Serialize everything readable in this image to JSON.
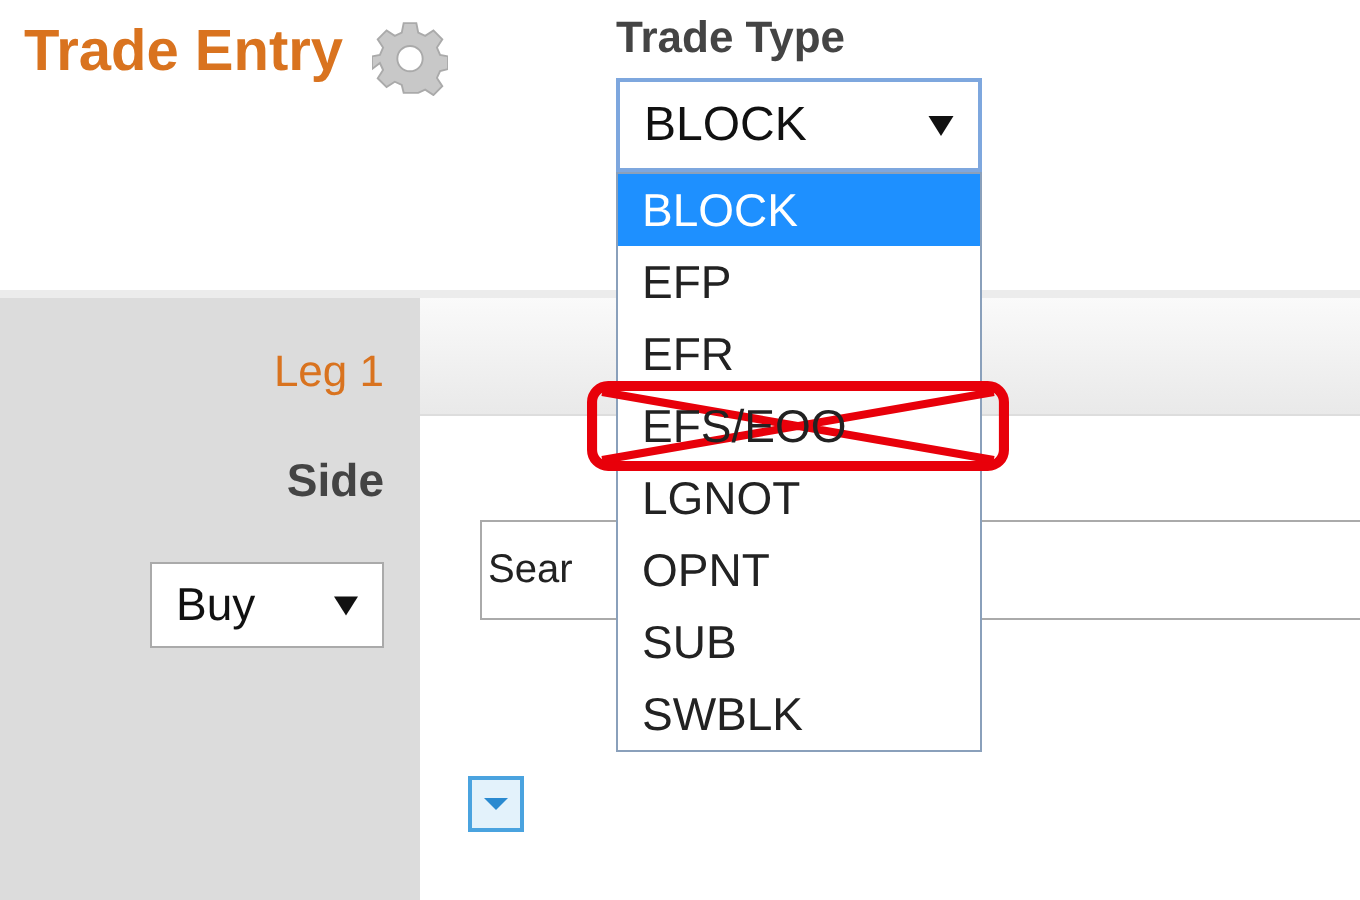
{
  "header": {
    "title": "Trade Entry"
  },
  "trade_type": {
    "label": "Trade Type",
    "value": "BLOCK",
    "expanded": true,
    "options": [
      {
        "label": "BLOCK",
        "selected": true,
        "crossed_out": false
      },
      {
        "label": "EFP",
        "selected": false,
        "crossed_out": false
      },
      {
        "label": "EFR",
        "selected": false,
        "crossed_out": false
      },
      {
        "label": "EFS/EOO",
        "selected": false,
        "crossed_out": true
      },
      {
        "label": "LGNOT",
        "selected": false,
        "crossed_out": false
      },
      {
        "label": "OPNT",
        "selected": false,
        "crossed_out": false
      },
      {
        "label": "SUB",
        "selected": false,
        "crossed_out": false
      },
      {
        "label": "SWBLK",
        "selected": false,
        "crossed_out": false
      }
    ]
  },
  "leg": {
    "title": "Leg 1",
    "side_label": "Side",
    "side_value": "Buy",
    "search_value": "Sear"
  }
}
